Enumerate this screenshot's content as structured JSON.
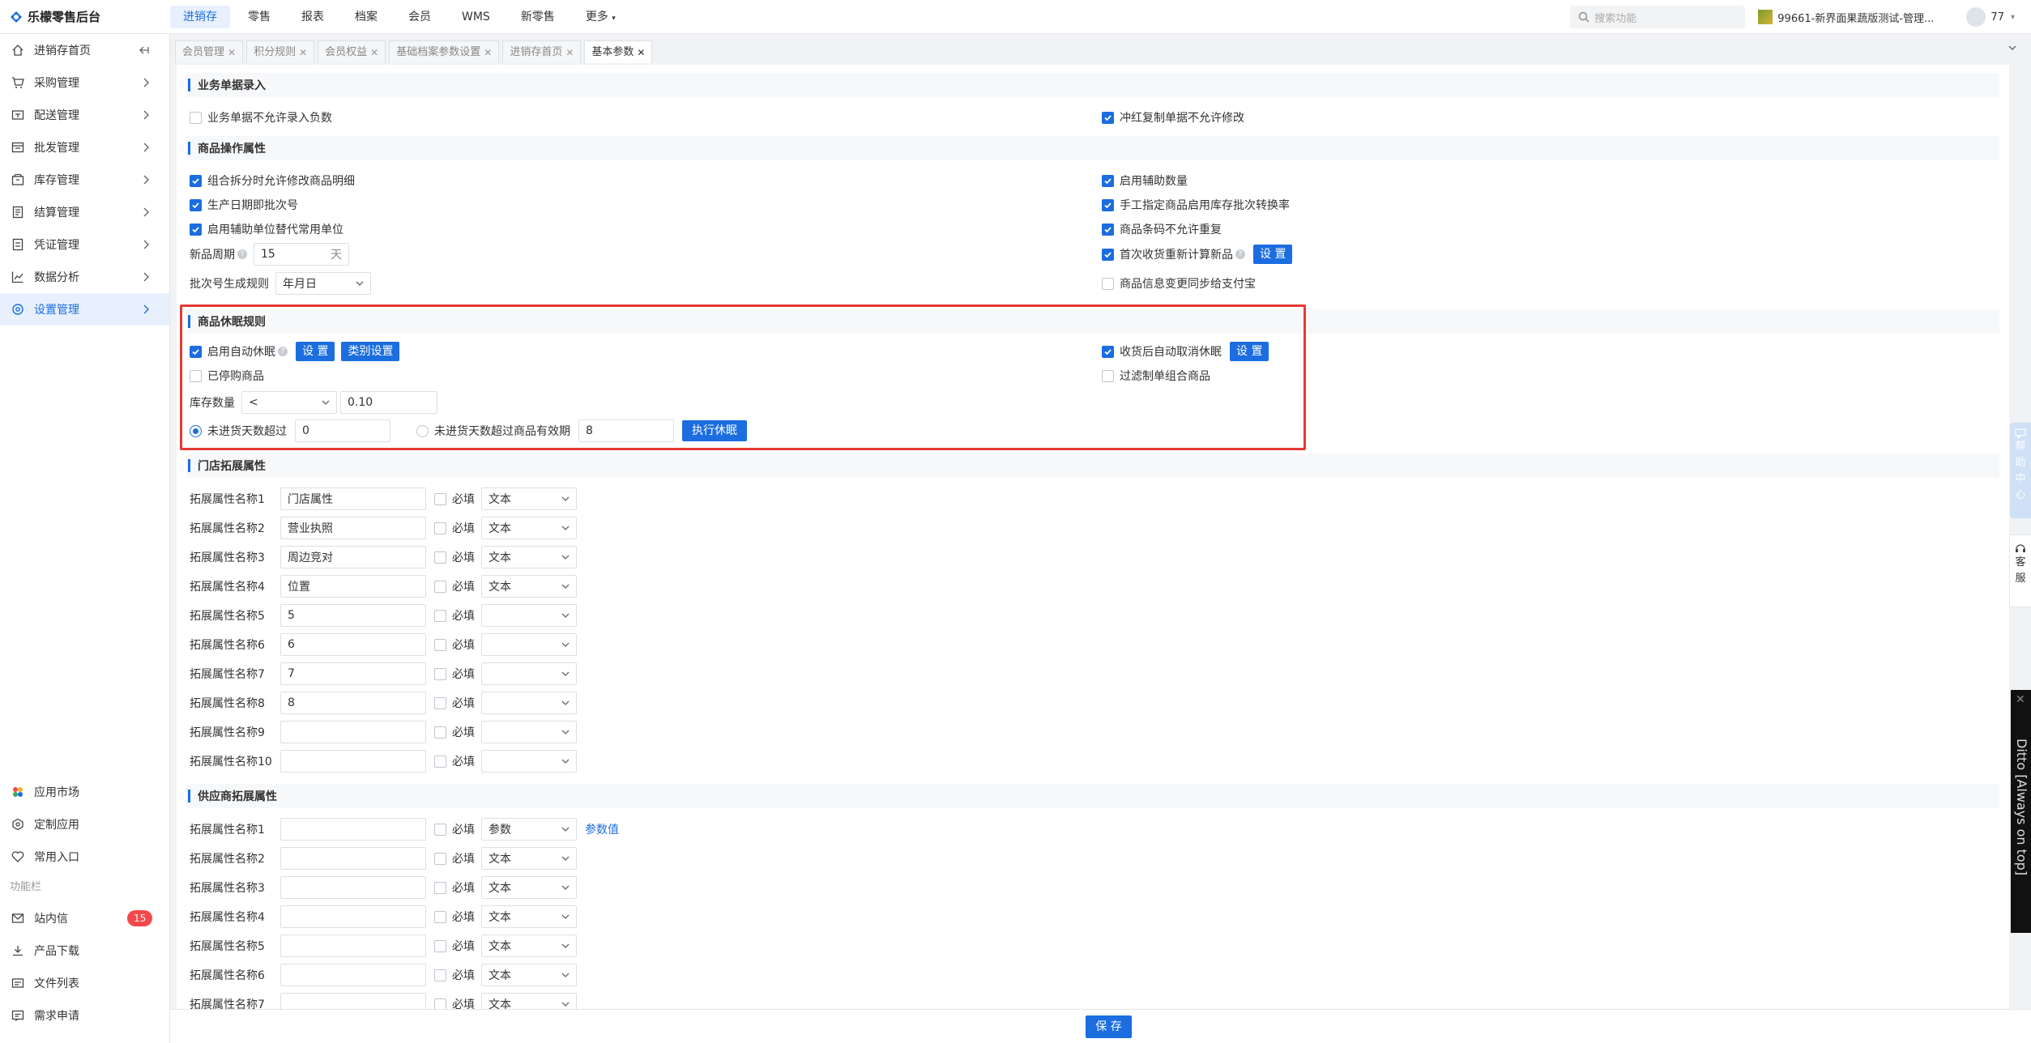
{
  "app": {
    "title": "乐檬零售后台"
  },
  "topnav": [
    {
      "label": "进销存",
      "active": true
    },
    {
      "label": "零售"
    },
    {
      "label": "报表"
    },
    {
      "label": "档案"
    },
    {
      "label": "会员"
    },
    {
      "label": "WMS"
    },
    {
      "label": "新零售"
    },
    {
      "label": "更多"
    }
  ],
  "search": {
    "placeholder": "搜索功能"
  },
  "store": {
    "label": "99661-新界面果蔬版测试-管理..."
  },
  "user": {
    "name": "77"
  },
  "sidebar": {
    "items": [
      {
        "label": "进销存首页",
        "icon": "home-icon"
      },
      {
        "label": "采购管理",
        "icon": "cart-icon"
      },
      {
        "label": "配送管理",
        "icon": "delivery-icon"
      },
      {
        "label": "批发管理",
        "icon": "wholesale-icon"
      },
      {
        "label": "库存管理",
        "icon": "inventory-icon"
      },
      {
        "label": "结算管理",
        "icon": "settlement-icon"
      },
      {
        "label": "凭证管理",
        "icon": "voucher-icon"
      },
      {
        "label": "数据分析",
        "icon": "chart-icon"
      },
      {
        "label": "设置管理",
        "icon": "settings-icon",
        "active": true
      }
    ],
    "bottom": [
      {
        "label": "应用市场",
        "icon": "app-market-icon"
      },
      {
        "label": "定制应用",
        "icon": "custom-app-icon"
      },
      {
        "label": "常用入口",
        "icon": "heart-icon"
      }
    ],
    "section_label": "功能栏",
    "func": [
      {
        "label": "站内信",
        "icon": "mail-icon",
        "badge": "15"
      },
      {
        "label": "产品下载",
        "icon": "download-icon"
      },
      {
        "label": "文件列表",
        "icon": "file-list-icon"
      },
      {
        "label": "需求申请",
        "icon": "request-icon"
      }
    ]
  },
  "tabs": [
    {
      "label": "会员管理"
    },
    {
      "label": "积分规则"
    },
    {
      "label": "会员权益"
    },
    {
      "label": "基础档案参数设置"
    },
    {
      "label": "进销存首页"
    },
    {
      "label": "基本参数",
      "active": true
    }
  ],
  "sections": {
    "entry": {
      "title": "业务单据录入",
      "neg": {
        "label": "业务单据不允许录入负数",
        "checked": false
      },
      "redcopy": {
        "label": "冲红复制单据不允许修改",
        "checked": true
      }
    },
    "product": {
      "title": "商品操作属性",
      "split": {
        "label": "组合拆分时允许修改商品明细",
        "checked": true
      },
      "aux_qty": {
        "label": "启用辅助数量",
        "checked": true
      },
      "batch": {
        "label": "生产日期即批次号",
        "checked": true
      },
      "manual_batch": {
        "label": "手工指定商品启用库存批次转换率",
        "checked": true
      },
      "aux_unit": {
        "label": "启用辅助单位替代常用单位",
        "checked": true
      },
      "barcode": {
        "label": "商品条码不允许重复",
        "checked": true
      },
      "new_period_label": "新品周期",
      "new_period_value": "15",
      "new_period_unit": "天",
      "first_receive": {
        "label": "首次收货重新计算新品",
        "checked": true
      },
      "set_label": "设 置",
      "batch_rule_label": "批次号生成规则",
      "batch_rule_value": "年月日",
      "alipay": {
        "label": "商品信息变更同步给支付宝",
        "checked": false
      }
    },
    "dormant": {
      "title": "商品休眠规则",
      "auto": {
        "label": "启用自动休眠",
        "checked": true
      },
      "set_label": "设 置",
      "category_label": "类别设置",
      "cancel_after": {
        "label": "收货后自动取消休眠",
        "checked": true
      },
      "set2_label": "设 置",
      "stopped": {
        "label": "已停购商品",
        "checked": false
      },
      "filter_combo": {
        "label": "过滤制单组合商品",
        "checked": false
      },
      "stock_label": "库存数量",
      "stock_op": "<",
      "stock_value": "0.10",
      "days_over": {
        "label": "未进货天数超过",
        "checked": true,
        "value": "0"
      },
      "days_over_valid": {
        "label": "未进货天数超过商品有效期",
        "checked": false,
        "value": "8"
      },
      "exec_label": "执行休眠"
    },
    "store_ext": {
      "title": "门店拓展属性",
      "required_label": "必填",
      "rows": [
        {
          "name": "拓展属性名称1",
          "value": "门店属性",
          "type": "文本"
        },
        {
          "name": "拓展属性名称2",
          "value": "营业执照",
          "type": "文本"
        },
        {
          "name": "拓展属性名称3",
          "value": "周边竞对",
          "type": "文本"
        },
        {
          "name": "拓展属性名称4",
          "value": "位置",
          "type": "文本"
        },
        {
          "name": "拓展属性名称5",
          "value": "5",
          "type": ""
        },
        {
          "name": "拓展属性名称6",
          "value": "6",
          "type": ""
        },
        {
          "name": "拓展属性名称7",
          "value": "7",
          "type": ""
        },
        {
          "name": "拓展属性名称8",
          "value": "8",
          "type": ""
        },
        {
          "name": "拓展属性名称9",
          "value": "",
          "type": ""
        },
        {
          "name": "拓展属性名称10",
          "value": "",
          "type": ""
        }
      ]
    },
    "supplier_ext": {
      "title": "供应商拓展属性",
      "required_label": "必填",
      "param_link": "参数值",
      "rows": [
        {
          "name": "拓展属性名称1",
          "value": "",
          "type": "参数"
        },
        {
          "name": "拓展属性名称2",
          "value": "",
          "type": "文本"
        },
        {
          "name": "拓展属性名称3",
          "value": "",
          "type": "文本"
        },
        {
          "name": "拓展属性名称4",
          "value": "",
          "type": "文本"
        },
        {
          "name": "拓展属性名称5",
          "value": "",
          "type": "文本"
        },
        {
          "name": "拓展属性名称6",
          "value": "",
          "type": "文本"
        },
        {
          "name": "拓展属性名称7",
          "value": "",
          "type": "文本"
        }
      ]
    }
  },
  "footer": {
    "save_label": "保 存"
  },
  "float": {
    "help": [
      "帮",
      "助",
      "中",
      "心"
    ],
    "cs": [
      "客",
      "服"
    ],
    "ditto": "Ditto [Always on top]"
  },
  "colors": {
    "accent": "#1b6de0",
    "highlight": "#e53935",
    "badge": "#f5484a"
  }
}
